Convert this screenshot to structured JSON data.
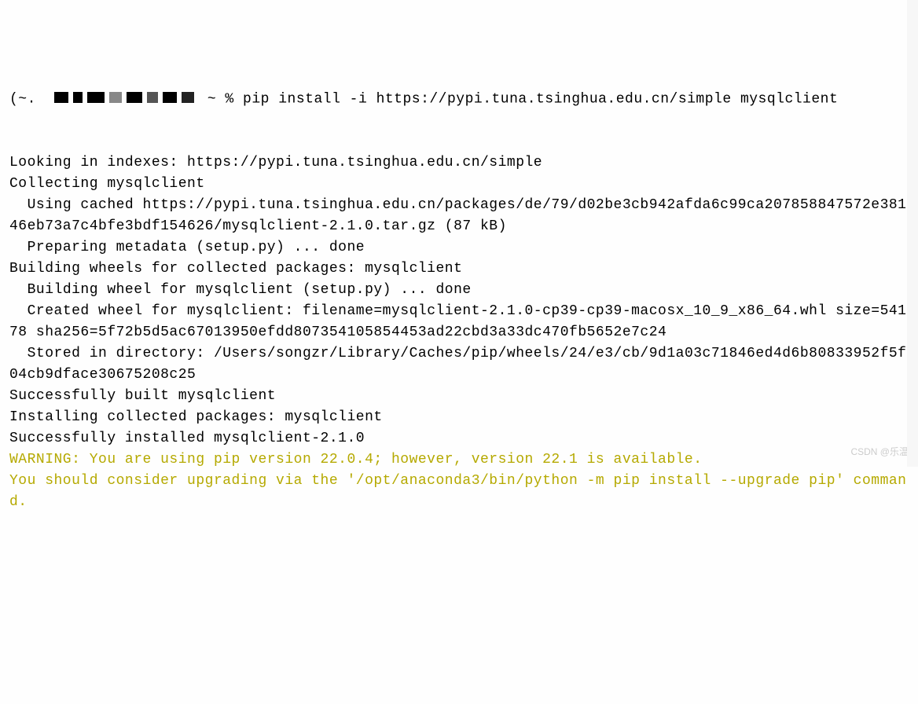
{
  "prompt": {
    "user_host_prefix": "(~.  ",
    "path_symbol": "~ % ",
    "command": "pip install -i https://pypi.tuna.tsinghua.edu.cn/simple mysqlclient"
  },
  "output": {
    "blank1": "",
    "line1": "Looking in indexes: https://pypi.tuna.tsinghua.edu.cn/simple",
    "line2": "Collecting mysqlclient",
    "line3": "  Using cached https://pypi.tuna.tsinghua.edu.cn/packages/de/79/d02be3cb942afda6c99ca207858847572e38146eb73a7c4bfe3bdf154626/mysqlclient-2.1.0.tar.gz (87 kB)",
    "line4": "  Preparing metadata (setup.py) ... done",
    "line5": "Building wheels for collected packages: mysqlclient",
    "line6": "  Building wheel for mysqlclient (setup.py) ... done",
    "line7": "  Created wheel for mysqlclient: filename=mysqlclient-2.1.0-cp39-cp39-macosx_10_9_x86_64.whl size=54178 sha256=5f72b5d5ac67013950efdd807354105854453ad22cbd3a33dc470fb5652e7c24",
    "line8": "  Stored in directory: /Users/songzr/Library/Caches/pip/wheels/24/e3/cb/9d1a03c71846ed4d6b80833952f5f04cb9dface30675208c25",
    "line9": "Successfully built mysqlclient",
    "line10": "Installing collected packages: mysqlclient",
    "line11": "Successfully installed mysqlclient-2.1.0"
  },
  "warning": {
    "line1": "WARNING: You are using pip version 22.0.4; however, version 22.1 is available.",
    "line2": "You should consider upgrading via the '/opt/anaconda3/bin/python -m pip install --upgrade pip' command."
  },
  "watermark": "CSDN @乐温"
}
